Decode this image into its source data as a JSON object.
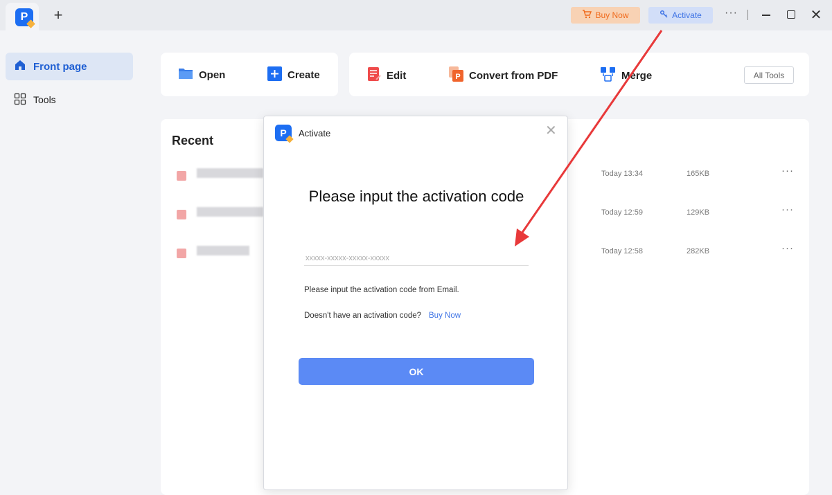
{
  "titlebar": {
    "buy_now_label": "Buy Now",
    "activate_label": "Activate",
    "more_label": "···",
    "new_tab_label": "+",
    "close_label": "✕"
  },
  "sidebar": {
    "items": [
      {
        "label": "Front page",
        "icon": "home-icon"
      },
      {
        "label": "Tools",
        "icon": "grid-icon"
      }
    ]
  },
  "toolbar": {
    "open_label": "Open",
    "create_label": "Create",
    "edit_label": "Edit",
    "convert_label": "Convert from PDF",
    "merge_label": "Merge",
    "all_tools_label": "All Tools"
  },
  "recent": {
    "title": "Recent",
    "files": [
      {
        "date": "Today 13:34",
        "size": "165KB"
      },
      {
        "date": "Today 12:59",
        "size": "129KB"
      },
      {
        "date": "Today 12:58",
        "size": "282KB"
      }
    ],
    "more_label": "···"
  },
  "dialog": {
    "title": "Activate",
    "heading": "Please input the activation code",
    "input_placeholder": "xxxxx-xxxxx-xxxxx-xxxxx",
    "hint": "Please input the activation code from Email.",
    "no_code_text": "Doesn't have an activation code?",
    "buy_now_link": "Buy Now",
    "ok_label": "OK",
    "close_label": "✕"
  },
  "colors": {
    "accent": "#3f74e5",
    "ok_button": "#5b8af5",
    "buy_now_bg": "#f8d2b4",
    "activate_bg": "#d2def8",
    "annotation_arrow": "#e8393a"
  }
}
